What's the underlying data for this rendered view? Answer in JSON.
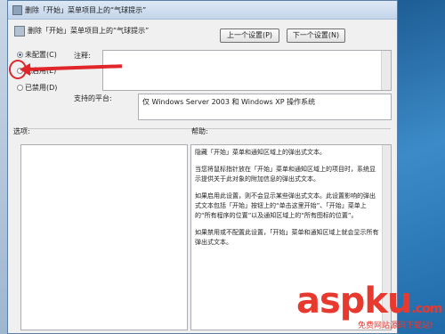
{
  "window": {
    "title": "删除「开始」菜单项目上的“气球提示”",
    "setting_title": "删除「开始」菜单项目上的“气球提示”"
  },
  "nav": {
    "prev_label": "上一个设置(P)",
    "next_label": "下一个设置(N)"
  },
  "state": {
    "not_configured": "未配置(C)",
    "enabled": "已启用(E)",
    "disabled": "已禁用(D)",
    "selected": "not_configured"
  },
  "labels": {
    "comment": "注释:",
    "supported": "支持的平台:",
    "options": "选项:",
    "help": "帮助:"
  },
  "supported_value": "仅 Windows Server 2003 和 Windows XP 操作系统",
  "help_text": [
    "隐藏「开始」菜单和通知区域上的弹出式文本。",
    "当您将鼠标指针放在「开始」菜单和通知区域上的项目时，系统显示提供关于此对象的附加信息的弹出式文本。",
    "如果启用此设置，则不会显示某些弹出式文本。此设置影响的弹出式文本包括「开始」按钮上的“单击这里开始”、「开始」菜单上的“所有程序的位置”以及通知区域上的“所有图标的位置”。",
    "如果禁用或不配置此设置，「开始」菜单和通知区域上就会显示所有弹出式文本。"
  ],
  "watermark": {
    "brand": "aspku",
    "suffix": ".com",
    "tagline": "免费网站源码下载站!"
  },
  "colors": {
    "annotation_red": "#e0262b",
    "desktop_blue": "#2b7ab3"
  }
}
